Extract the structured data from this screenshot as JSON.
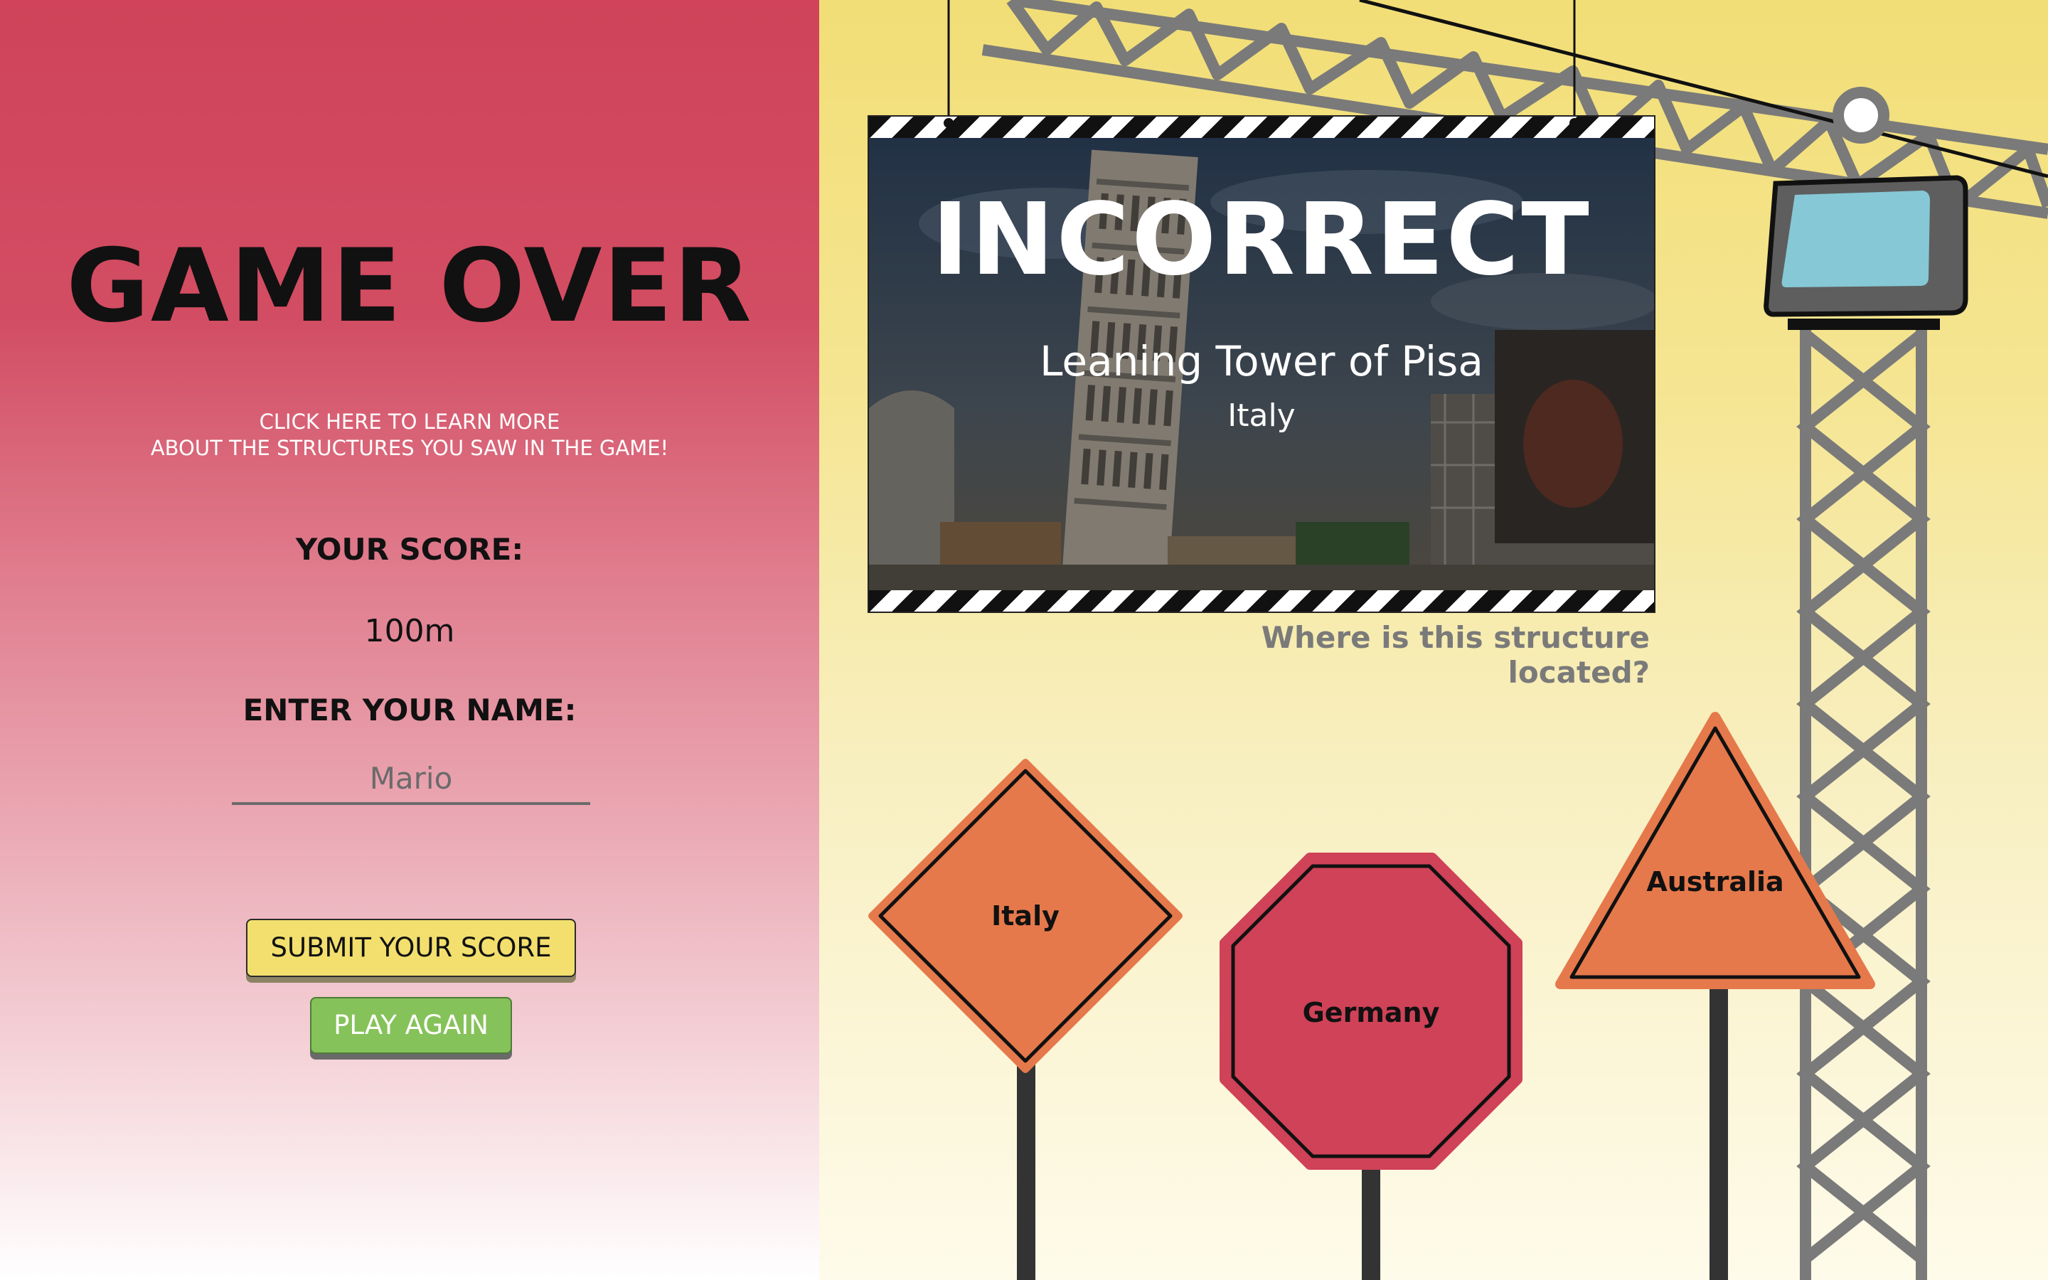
{
  "left": {
    "title": "GAME OVER",
    "learn_more_line1": "CLICK HERE TO LEARN MORE",
    "learn_more_line2": "ABOUT THE STRUCTURES YOU SAW IN THE GAME!",
    "score_label": "YOUR SCORE:",
    "score_value": "100m",
    "name_label": "ENTER YOUR NAME:",
    "name_placeholder": "Mario",
    "submit_label": "SUBMIT YOUR SCORE",
    "play_again_label": "PLAY AGAIN"
  },
  "board": {
    "result": "INCORRECT",
    "structure_name": "Leaning Tower of Pisa",
    "structure_country": "Italy"
  },
  "question": "Where is this structure located?",
  "answers": [
    {
      "label": "Italy",
      "shape": "diamond",
      "color": "#e5794b"
    },
    {
      "label": "Germany",
      "shape": "octagon",
      "color": "#cf4257"
    },
    {
      "label": "Australia",
      "shape": "triangle",
      "color": "#e5794b"
    }
  ],
  "colors": {
    "left_bg": "#d0435a",
    "right_bg": "#f2de76",
    "submit_button": "#f3df6e",
    "play_button": "#86c25a",
    "crane": "#7a7a7a",
    "cab_window": "#86c8d6"
  }
}
